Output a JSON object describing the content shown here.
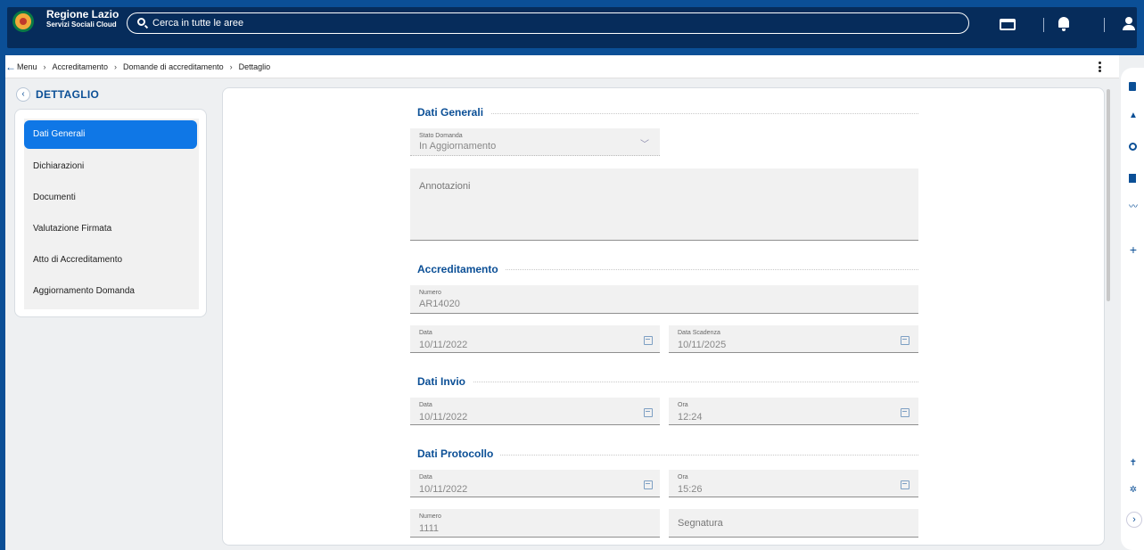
{
  "app": {
    "title": "Regione Lazio",
    "subtitle": "Servizi Sociali Cloud",
    "search_placeholder": "Cerca in tutte le aree"
  },
  "breadcrumb": [
    "Menu",
    "Accreditamento",
    "Domande di accreditamento",
    "Dettaglio"
  ],
  "sidebar": {
    "title": "DETTAGLIO",
    "items": [
      {
        "label": "Dati Generali",
        "active": true
      },
      {
        "label": "Dichiarazioni",
        "active": false
      },
      {
        "label": "Documenti",
        "active": false
      },
      {
        "label": "Valutazione Firmata",
        "active": false
      },
      {
        "label": "Atto di Accreditamento",
        "active": false
      },
      {
        "label": "Aggiornamento Domanda",
        "active": false
      }
    ]
  },
  "form": {
    "dati_generali": {
      "title": "Dati Generali",
      "stato_label": "Stato Domanda",
      "stato_value": "In Aggiornamento",
      "annotazioni_placeholder": "Annotazioni"
    },
    "accreditamento": {
      "title": "Accreditamento",
      "numero_label": "Numero",
      "numero_value": "AR14020",
      "data_label": "Data",
      "data_value": "10/11/2022",
      "scadenza_label": "Data Scadenza",
      "scadenza_value": "10/11/2025"
    },
    "dati_invio": {
      "title": "Dati Invio",
      "data_label": "Data",
      "data_value": "10/11/2022",
      "ora_label": "Ora",
      "ora_value": "12:24"
    },
    "dati_protocollo": {
      "title": "Dati Protocollo",
      "data_label": "Data",
      "data_value": "10/11/2022",
      "ora_label": "Ora",
      "ora_value": "15:26",
      "numero_label": "Numero",
      "numero_value": "1111",
      "segnatura_placeholder": "Segnatura"
    }
  },
  "colors": {
    "primary": "#0b4f96",
    "active": "#0f77e6",
    "field_bg": "#f1f1f1"
  },
  "icons": {
    "rail": [
      "calculator-icon",
      "dashboard-icon",
      "history-icon",
      "book-icon",
      "chart-icon",
      "plus-icon",
      "accessibility-icon",
      "gear-icon",
      "chevron-right-icon"
    ]
  }
}
